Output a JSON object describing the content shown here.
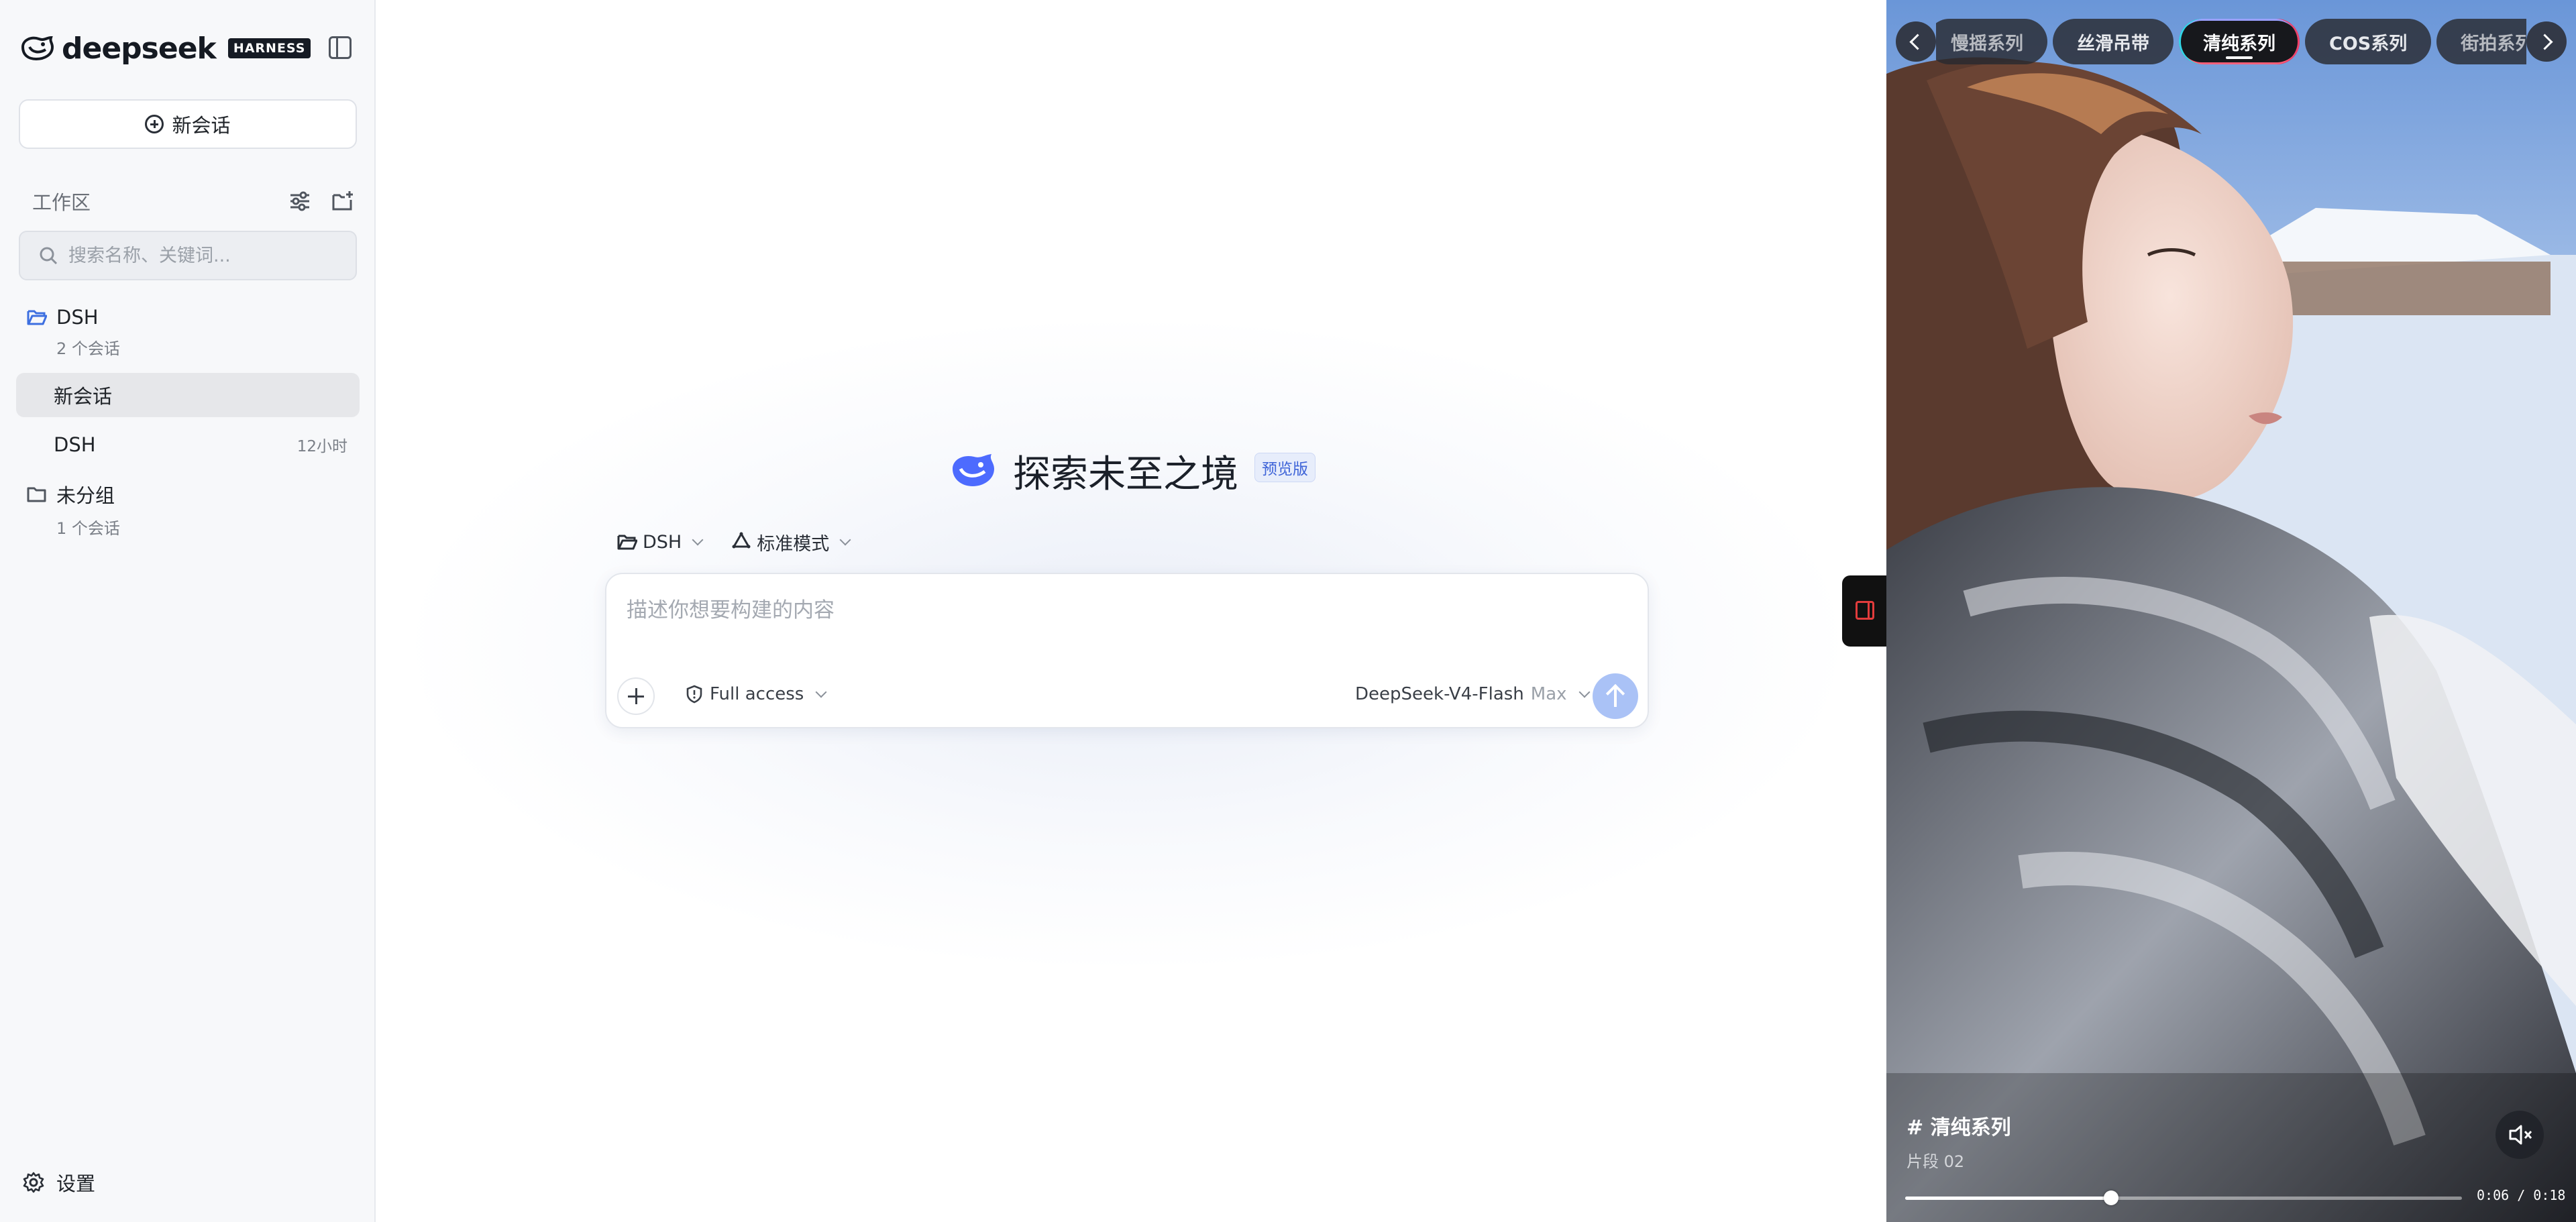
{
  "colors": {
    "accent": "#4d6bfe",
    "send_button": "#aac2f6",
    "sidebar_bg": "#f7f8fa",
    "badge_bg": "#e7edfb"
  },
  "sidebar": {
    "brand_name": "deepseek",
    "brand_badge": "HARNESS",
    "toggle_icon": "sidebar-toggle-icon",
    "new_chat_label": "新会话",
    "workspace_title": "工作区",
    "search_placeholder": "搜索名称、关键词...",
    "groups": [
      {
        "name": "DSH",
        "count": "2 个会话",
        "icon": "folder-open-icon"
      },
      {
        "name": "未分组",
        "count": "1 个会话",
        "icon": "folder-icon"
      }
    ],
    "sessions": [
      {
        "title": "新会话",
        "time": ""
      },
      {
        "title": "DSH",
        "time": "12小时"
      }
    ],
    "settings_label": "设置"
  },
  "main": {
    "hero_title": "探索未至之境",
    "hero_badge": "预览版",
    "project_selector": "DSH",
    "mode_selector": "标准模式",
    "input_placeholder": "描述你想要构建的内容",
    "access_label": "Full access",
    "model_name": "DeepSeek-V4-Flash",
    "model_tier": "Max"
  },
  "video_panel": {
    "tabs": [
      "慢摇系列",
      "丝滑吊带",
      "清纯系列",
      "COS系列",
      "街拍系列"
    ],
    "active_tab": "清纯系列",
    "caption_tag": "# 清纯系列",
    "caption_sub": "片段 02",
    "current_time": "0:06",
    "duration": "0:18",
    "time_display": "0:06 / 0:18",
    "progress": 0.37,
    "muted": true
  }
}
